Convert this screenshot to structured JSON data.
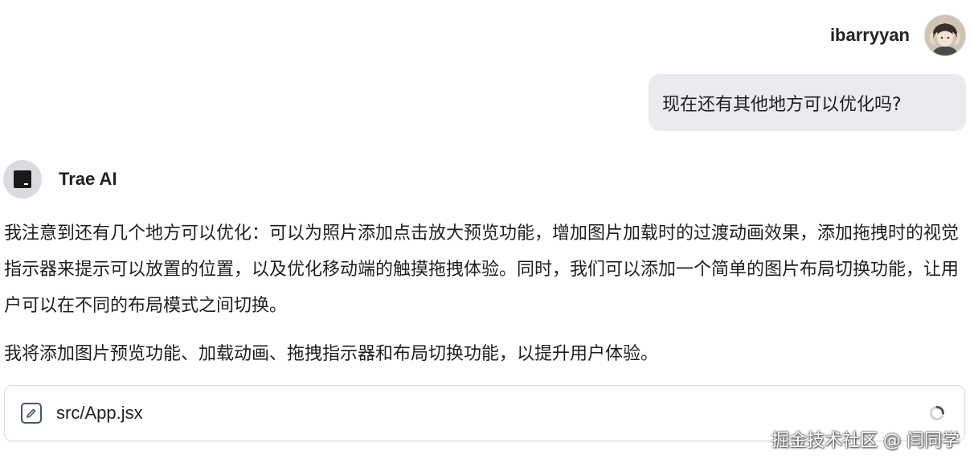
{
  "user": {
    "name": "ibarryyan",
    "message": "现在还有其他地方可以优化吗?"
  },
  "assistant": {
    "name": "Trae AI",
    "paragraph1": "我注意到还有几个地方可以优化：可以为照片添加点击放大预览功能，增加图片加载时的过渡动画效果，添加拖拽时的视觉指示器来提示可以放置的位置，以及优化移动端的触摸拖拽体验。同时，我们可以添加一个简单的图片布局切换功能，让用户可以在不同的布局模式之间切换。",
    "paragraph2": "我将添加图片预览功能、加载动画、拖拽指示器和布局切换功能，以提升用户体验。"
  },
  "file_card": {
    "icon": "edit-file-icon",
    "file_name": "src/App.jsx",
    "status_icon": "loading-spinner-icon"
  },
  "watermark": "掘金技术社区 @ 闫同学",
  "colors": {
    "bubble_bg": "#e9ebee",
    "logo_bg": "#d9dbde",
    "text": "#1f1f1f"
  }
}
